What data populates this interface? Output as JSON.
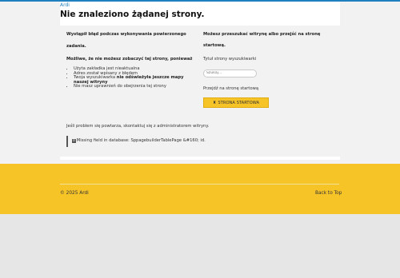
{
  "header": {
    "site_link": "Ardi",
    "title": "Nie znaleziono żądanej strony."
  },
  "left": {
    "intro_line1": "Wystąpił błąd podczas wykonywania powierzonego",
    "intro_line2": "zadania.",
    "cause_heading": "Możliwe, że nie możesz zobaczyć tej strony, ponieważ",
    "reasons": [
      "Użyta zakładka jest nieaktualna",
      "Adres został wpisany z błędem",
      "Twoja wyszukiwarka",
      "nie odświeżyła jeszcze mapy",
      "naszej witryny",
      "Nie masz uprawnień do obejrzenia tej strony"
    ],
    "persist_note": "Jeśli problem się powtarza, skontaktuj się z administratorem witryny.",
    "error_badge": "0",
    "error_message": "Missing field in database: SppagebuilderTablePage &#160; id."
  },
  "right": {
    "search_hint_line1": "Możesz przeszukać witrynę albo przejść na stronę",
    "search_hint_line2": "startową.",
    "search_label": "Tytuł strony wyszukiwarki",
    "search_placeholder": "Szukaj...",
    "home_label": "Przejdź na stronę startową",
    "home_icon": "home-icon",
    "home_button": "STRONA STARTOWA"
  },
  "footer": {
    "copyright": "© 2025 Ardi",
    "back_to_top": "Back to Top"
  },
  "colors": {
    "accent": "#f7c428",
    "link": "#1f7fbf"
  }
}
